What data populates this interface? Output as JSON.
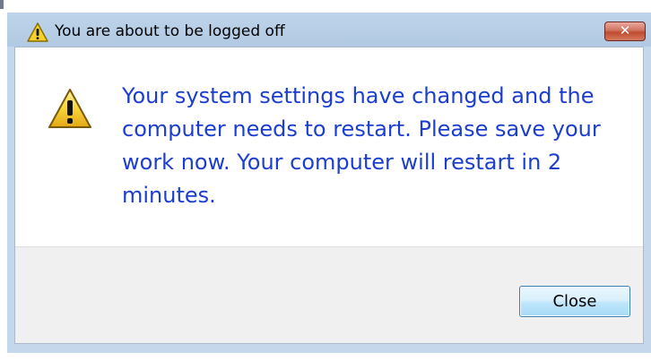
{
  "dialog": {
    "title": "You are about to be logged off",
    "title_icon": "warning-icon",
    "close_glyph": "✕",
    "message": "Your system settings have changed and the computer needs to restart. Please save your work now. Your computer will restart in 2 minutes.",
    "message_icon": "warning-icon",
    "close_button_label": "Close"
  },
  "colors": {
    "message_text": "#1c3ed0",
    "titlebar": "#bed4ea",
    "footer": "#f0f0f0",
    "close_x": "#c04a30"
  }
}
